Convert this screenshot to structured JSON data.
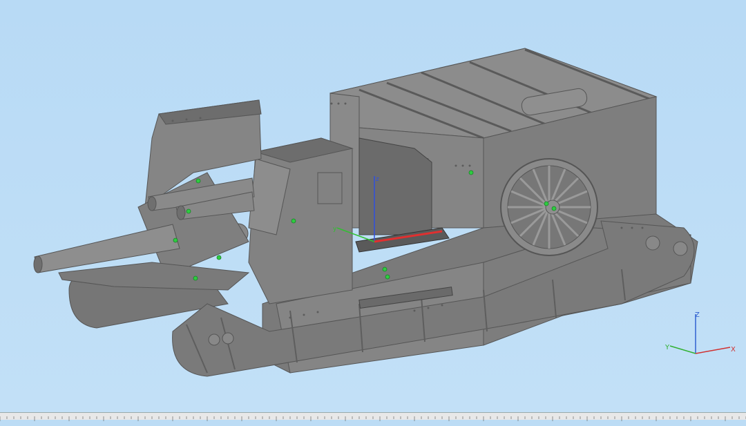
{
  "viewport": {
    "background": "#bcdcf5",
    "model": "artillery-tank-3d-model",
    "model_color": "#8a8a8a",
    "pivot_color": "#2ecc40"
  },
  "gizmo": {
    "axes": [
      {
        "name": "x",
        "color": "#e03030"
      },
      {
        "name": "y",
        "color": "#30c030"
      },
      {
        "name": "z",
        "color": "#3050e0"
      }
    ]
  },
  "triad": {
    "x_label": "X",
    "y_label": "Y",
    "z_label": "Z",
    "x_color": "#d03030",
    "y_color": "#30b030",
    "z_color": "#3060d0"
  }
}
